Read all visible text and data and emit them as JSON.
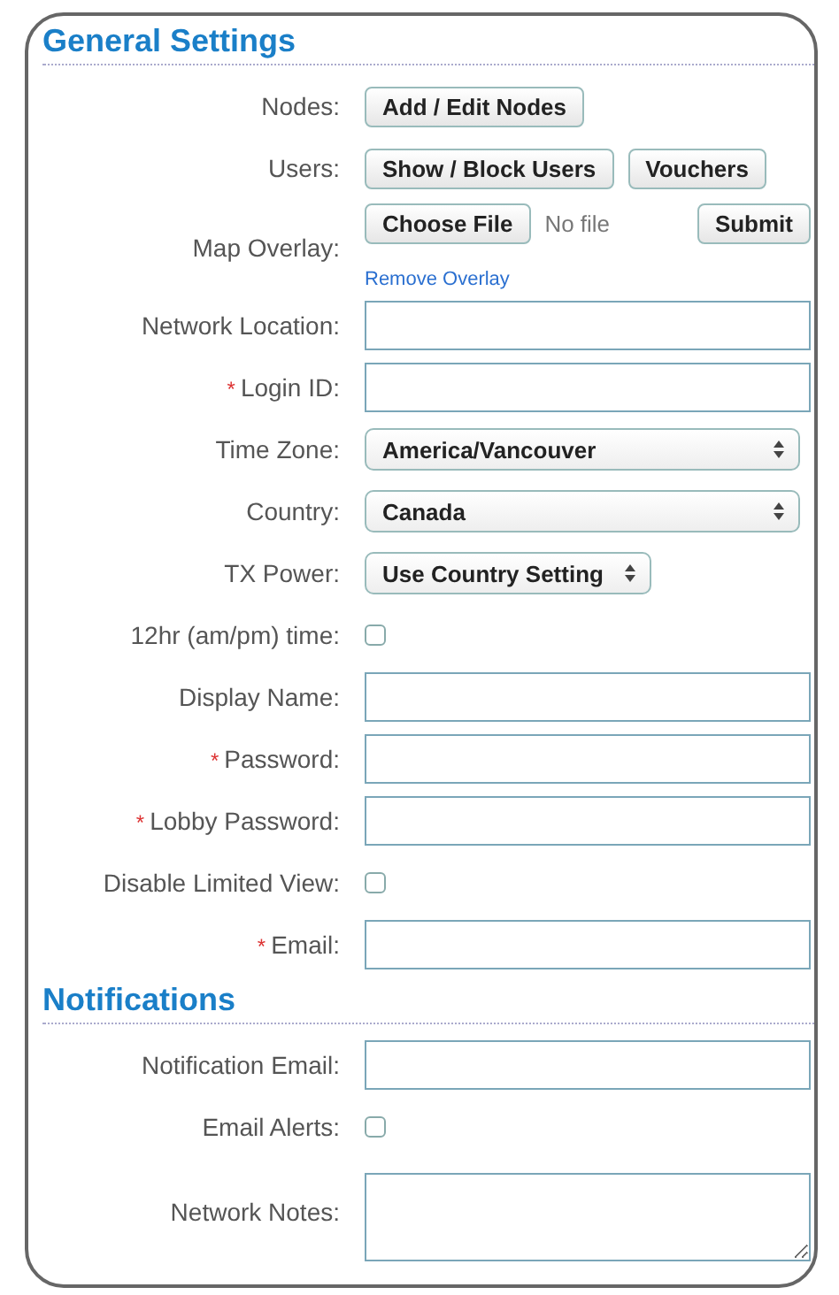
{
  "sections": [
    {
      "title": "General Settings",
      "rows": [
        {
          "kind": "buttons",
          "label": "Nodes:",
          "buttons": [
            "Add / Edit Nodes"
          ]
        },
        {
          "kind": "buttons",
          "label": "Users:",
          "buttons": [
            "Show / Block Users",
            "Vouchers"
          ]
        },
        {
          "kind": "file",
          "label": "Map Overlay:",
          "button": "Choose File",
          "file_status": "No file",
          "submit": "Submit",
          "link": "Remove Overlay"
        },
        {
          "kind": "text",
          "label": "Network Location:"
        },
        {
          "kind": "text",
          "label": "Login ID:",
          "required_mark": "*"
        },
        {
          "kind": "select",
          "label": "Time Zone:",
          "value": "America/Vancouver"
        },
        {
          "kind": "select",
          "label": "Country:",
          "value": "Canada"
        },
        {
          "kind": "compact-select",
          "label": "TX Power:",
          "value": "Use Country Setting"
        },
        {
          "kind": "checkbox",
          "label": "12hr (am/pm) time:",
          "checked": false
        },
        {
          "kind": "text",
          "label": "Display Name:"
        },
        {
          "kind": "text",
          "label": "Password:",
          "required_mark": "*"
        },
        {
          "kind": "text",
          "label": "Lobby Password:",
          "required_mark": "*"
        },
        {
          "kind": "checkbox",
          "label": "Disable Limited View:",
          "checked": false
        },
        {
          "kind": "text",
          "label": "Email:",
          "required_mark": "*"
        }
      ]
    },
    {
      "title": "Notifications",
      "rows": [
        {
          "kind": "text",
          "label": "Notification Email:"
        },
        {
          "kind": "checkbox",
          "label": "Email Alerts:",
          "checked": false
        },
        {
          "kind": "textarea",
          "label": "Network Notes:"
        }
      ]
    }
  ]
}
